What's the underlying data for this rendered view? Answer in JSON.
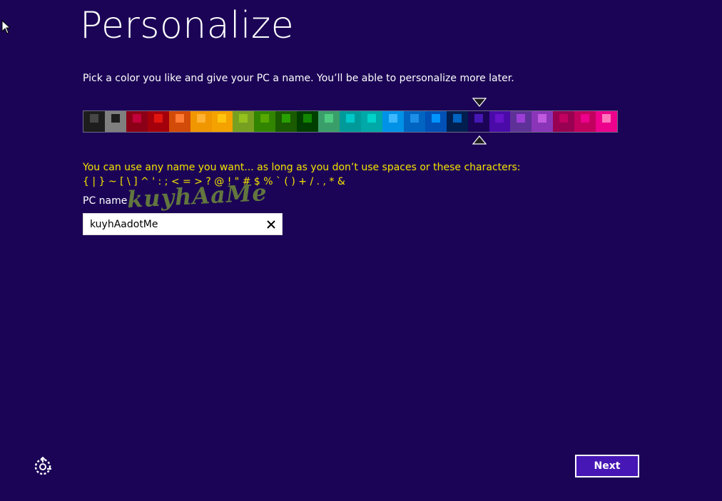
{
  "title": "Personalize",
  "subtitle": "Pick a color you like and give your PC a name. You’ll be able to personalize more later.",
  "palette": {
    "selected_index": 18,
    "swatches": [
      {
        "bg": "#1d1d1d",
        "fg": "#474747"
      },
      {
        "bg": "#7f7f7f",
        "fg": "#1d1d1d"
      },
      {
        "bg": "#8b0016",
        "fg": "#c2003b"
      },
      {
        "bg": "#a4000c",
        "fg": "#e1150f"
      },
      {
        "bg": "#d34b08",
        "fg": "#ff7c35"
      },
      {
        "bg": "#f09600",
        "fg": "#ffb234"
      },
      {
        "bg": "#f3a200",
        "fg": "#ffc40e"
      },
      {
        "bg": "#78a020",
        "fg": "#95c11f"
      },
      {
        "bg": "#328500",
        "fg": "#57a800"
      },
      {
        "bg": "#1a5a00",
        "fg": "#28a000"
      },
      {
        "bg": "#003f00",
        "fg": "#118600"
      },
      {
        "bg": "#3a9e6a",
        "fg": "#4ecc82"
      },
      {
        "bg": "#009a9a",
        "fg": "#00c8c8"
      },
      {
        "bg": "#00a8a8",
        "fg": "#00d3c9"
      },
      {
        "bg": "#0092e7",
        "fg": "#3db8ff"
      },
      {
        "bg": "#0064c0",
        "fg": "#1e8fe8"
      },
      {
        "bg": "#0050b6",
        "fg": "#0093ff"
      },
      {
        "bg": "#001f4f",
        "fg": "#0064c1"
      },
      {
        "bg": "#1b0456",
        "fg": "#4617b4"
      },
      {
        "bg": "#4a0aa8",
        "fg": "#6512c8"
      },
      {
        "bg": "#5e3198",
        "fg": "#9c3ed6"
      },
      {
        "bg": "#8a35b8",
        "fg": "#c05adf"
      },
      {
        "bg": "#980051",
        "fg": "#c1005f"
      },
      {
        "bg": "#c2005e",
        "fg": "#ec008c"
      },
      {
        "bg": "#ec008c",
        "fg": "#ff76bc"
      }
    ]
  },
  "hint_line1": "You can use any name you want... as long as you don’t use spaces or these characters:",
  "hint_line2": "{ | } ~ [ \\ ] ^ ' : ; < = > ? @ ! \" # $ % ` ( ) + / . , * &",
  "pc_name_label": "PC name",
  "watermark": "kuyhAaMe",
  "pc_name_value": "kuyhAadotMe",
  "next_label": "Next",
  "icons": {
    "cursor": "arrow-cursor-icon",
    "clear": "close-icon",
    "ease_of_access": "ease-of-access-icon",
    "marker_down": "triangle-down-icon",
    "marker_up": "triangle-up-icon"
  },
  "colors": {
    "background": "#1b0456",
    "hint_text": "#f5e300",
    "next_button": "#4617b4"
  }
}
